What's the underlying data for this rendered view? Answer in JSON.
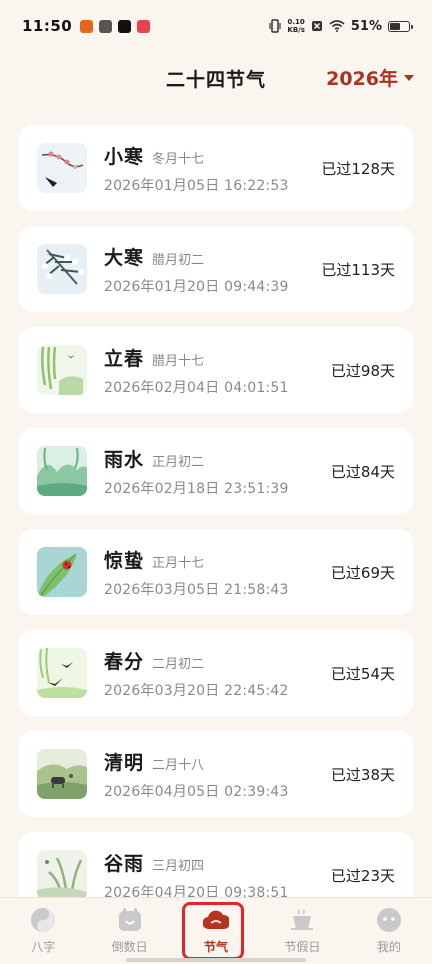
{
  "status_bar": {
    "time": "11:50",
    "net_speed_value": "0.10",
    "net_speed_unit": "KB/s",
    "battery": "51%"
  },
  "header": {
    "title": "二十四节气",
    "year": "2026年"
  },
  "terms": [
    {
      "name": "小寒",
      "lunar": "冬月十七",
      "datetime": "2026年01月05日 16:22:53",
      "passed": "已过128天"
    },
    {
      "name": "大寒",
      "lunar": "腊月初二",
      "datetime": "2026年01月20日 09:44:39",
      "passed": "已过113天"
    },
    {
      "name": "立春",
      "lunar": "腊月十七",
      "datetime": "2026年02月04日 04:01:51",
      "passed": "已过98天"
    },
    {
      "name": "雨水",
      "lunar": "正月初二",
      "datetime": "2026年02月18日 23:51:39",
      "passed": "已过84天"
    },
    {
      "name": "惊蛰",
      "lunar": "正月十七",
      "datetime": "2026年03月05日 21:58:43",
      "passed": "已过69天"
    },
    {
      "name": "春分",
      "lunar": "二月初二",
      "datetime": "2026年03月20日 22:45:42",
      "passed": "已过54天"
    },
    {
      "name": "清明",
      "lunar": "二月十八",
      "datetime": "2026年04月05日 02:39:43",
      "passed": "已过38天"
    },
    {
      "name": "谷雨",
      "lunar": "三月初四",
      "datetime": "2026年04月20日 09:38:51",
      "passed": "已过23天"
    }
  ],
  "nav": [
    {
      "label": "八字",
      "icon": "yin-yang-icon"
    },
    {
      "label": "倒数日",
      "icon": "calendar-icon"
    },
    {
      "label": "节气",
      "icon": "cloud-icon",
      "active": true
    },
    {
      "label": "节假日",
      "icon": "coffee-cup-icon"
    },
    {
      "label": "我的",
      "icon": "profile-icon"
    }
  ],
  "colors": {
    "accent": "#a8351f",
    "background": "#fbf5ef",
    "highlight": "#e0262b"
  }
}
